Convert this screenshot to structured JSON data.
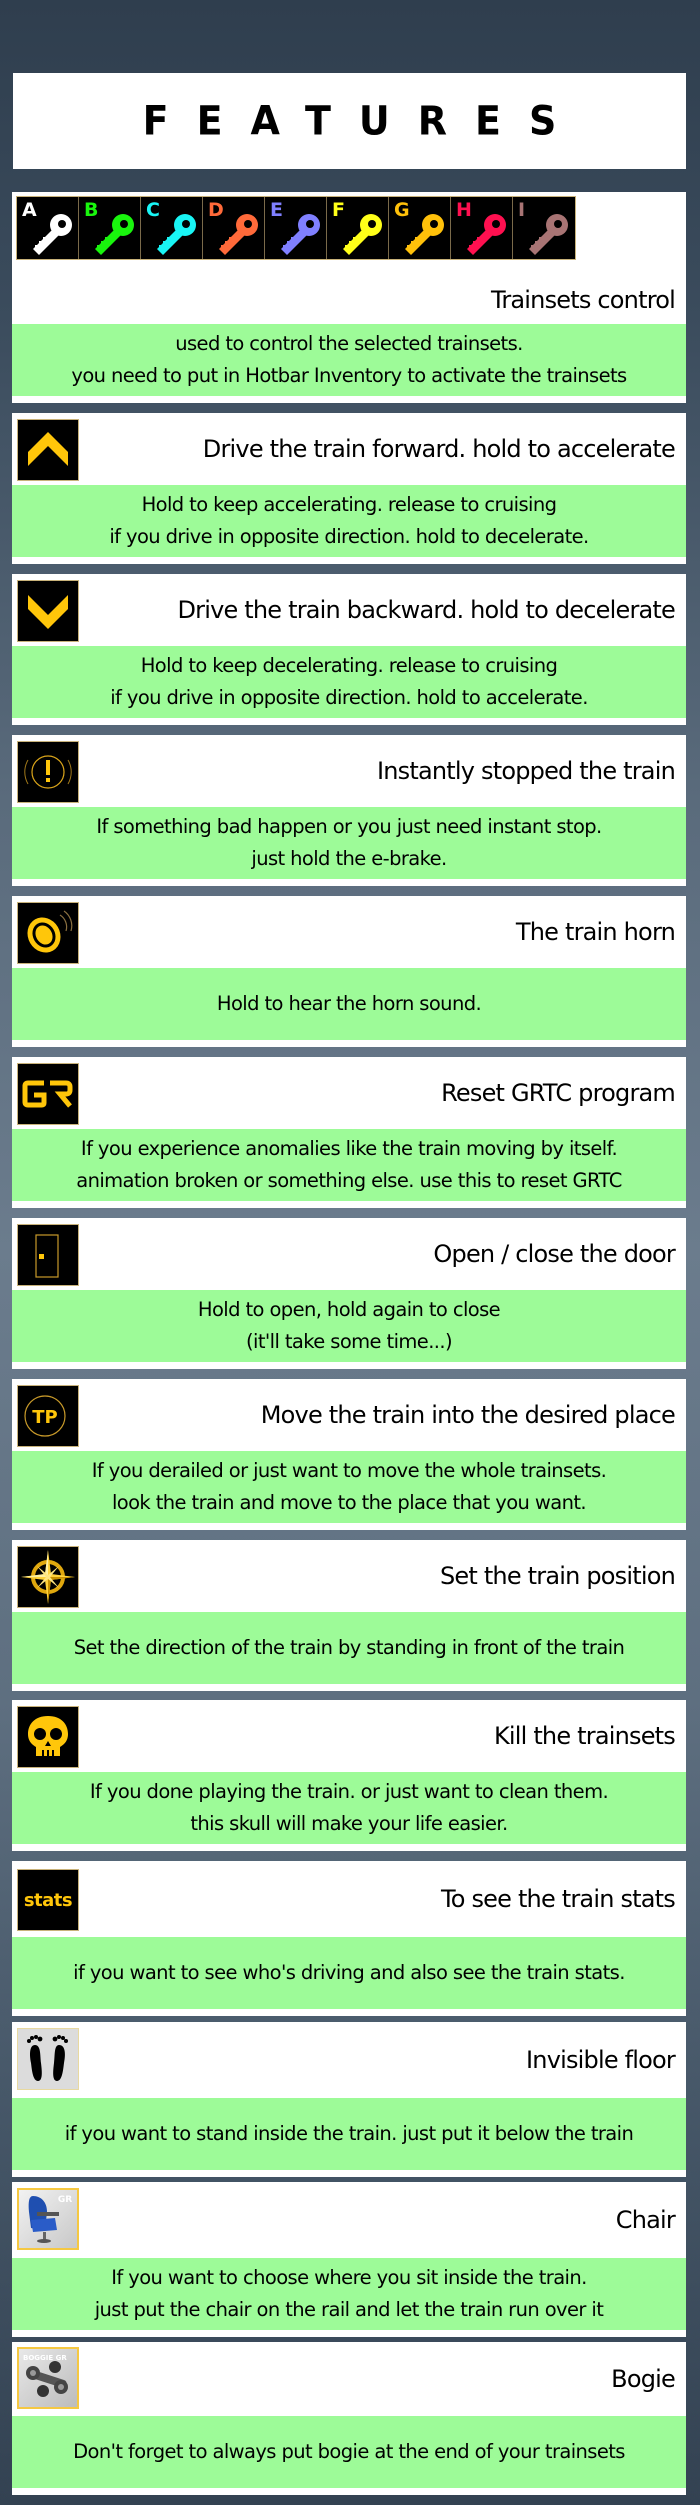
{
  "header": {
    "title": "FEATURES"
  },
  "keys": [
    {
      "letter": "A",
      "color": "#ffffff"
    },
    {
      "letter": "B",
      "color": "#19f50d"
    },
    {
      "letter": "C",
      "color": "#19f5f5"
    },
    {
      "letter": "D",
      "color": "#ff6a3a"
    },
    {
      "letter": "E",
      "color": "#8080ff"
    },
    {
      "letter": "F",
      "color": "#ffff19"
    },
    {
      "letter": "G",
      "color": "#ffc10a"
    },
    {
      "letter": "H",
      "color": "#ff1050"
    },
    {
      "letter": "I",
      "color": "#a87474"
    }
  ],
  "colors": {
    "accent": "#ffc60a",
    "description_bg": "#9dfb98",
    "card_bg": "#ffffff"
  },
  "features": [
    {
      "icon": "colored-keys-icon",
      "title": "Trainsets control",
      "lines": [
        "used to control the selected trainsets.",
        "you need to put in Hotbar Inventory to activate the trainsets"
      ]
    },
    {
      "icon": "chevron-up-icon",
      "title": "Drive the train forward. hold to accelerate",
      "lines": [
        "Hold to keep accelerating. release to cruising",
        "if you drive in opposite direction. hold to decelerate."
      ]
    },
    {
      "icon": "chevron-down-icon",
      "title": "Drive the train backward. hold to decelerate",
      "lines": [
        "Hold to keep decelerating. release to cruising",
        "if you drive in opposite direction. hold to accelerate."
      ]
    },
    {
      "icon": "emergency-brake-icon",
      "title": "Instantly stopped the train",
      "lines": [
        "If something bad happen or you just need instant stop.",
        "just hold the e-brake."
      ]
    },
    {
      "icon": "horn-icon",
      "title": "The train horn",
      "lines": [
        "Hold to hear the horn sound."
      ]
    },
    {
      "icon": "gr-reset-icon",
      "icon_text": "GR",
      "title": "Reset GRTC program",
      "lines": [
        "If you experience anomalies like the train moving by itself.",
        "animation broken or something else. use this to reset GRTC"
      ]
    },
    {
      "icon": "door-icon",
      "title": "Open / close the door",
      "lines": [
        "Hold to open, hold again to close",
        "(it'll take some time...)"
      ]
    },
    {
      "icon": "teleport-icon",
      "icon_text": "TP",
      "title": "Move the train into the desired place",
      "lines": [
        "If you derailed or just want to move the whole trainsets.",
        "look the train and move to the place that you want."
      ]
    },
    {
      "icon": "compass-icon",
      "title": "Set the train position",
      "lines": [
        "Set the direction of the train by standing in front of the train"
      ]
    },
    {
      "icon": "skull-icon",
      "title": "Kill the trainsets",
      "lines": [
        "If you done playing the train. or just want to clean them.",
        "this skull will make your life easier."
      ]
    },
    {
      "icon": "stats-icon",
      "icon_text": "stats",
      "title": "To see the train stats",
      "lines": [
        "if you want to see who's driving and also see the train stats."
      ]
    },
    {
      "icon": "footprints-icon",
      "title": "Invisible floor",
      "lines": [
        "if you want to stand inside the train. just put it below the train"
      ]
    },
    {
      "icon": "chair-icon",
      "icon_text": "GR",
      "title": "Chair",
      "lines": [
        "If you want to choose where you sit inside the train.",
        "just put the chair on the rail and let the train run over it"
      ]
    },
    {
      "icon": "bogie-icon",
      "icon_text": "BOGGIE GR",
      "title": "Bogie",
      "lines": [
        "Don't forget to always put bogie at the end of your trainsets"
      ]
    }
  ]
}
